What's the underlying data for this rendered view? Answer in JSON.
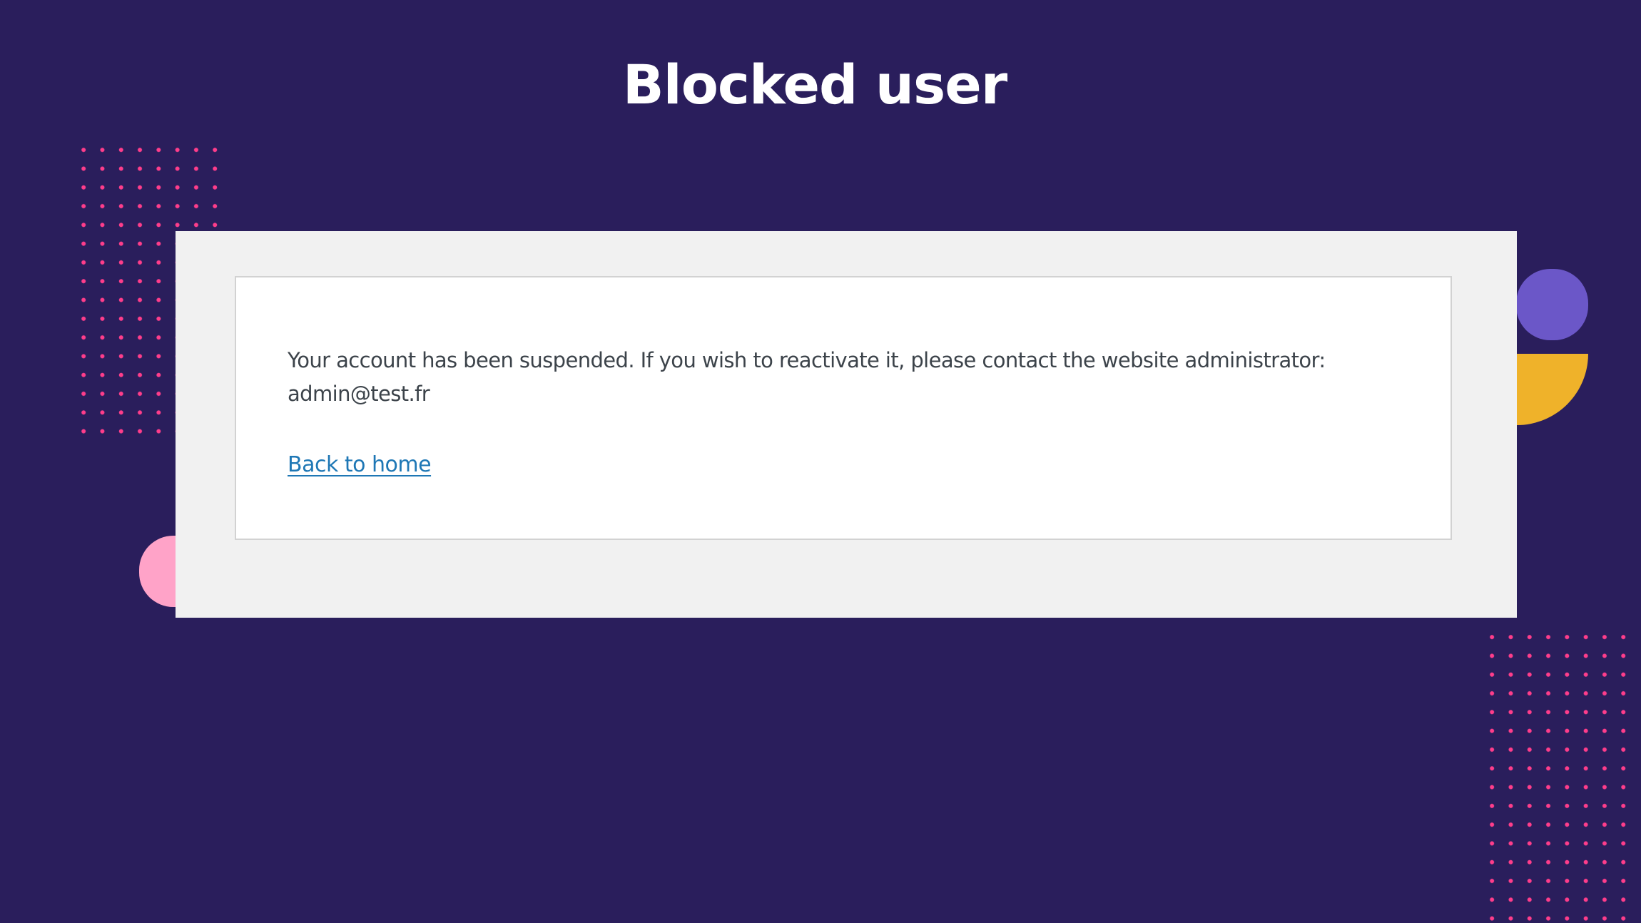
{
  "page": {
    "title": "Blocked user"
  },
  "message": {
    "text": "Your account has been suspended. If you wish to reactivate it, please contact the website administrator:",
    "email": "admin@test.fr"
  },
  "links": {
    "back_home": "Back to home"
  },
  "colors": {
    "background": "#2a1e5c",
    "dots": "#ff3d8b",
    "pink_blob": "#ffa3c8",
    "purple_blob": "#6b57c8",
    "yellow_blob": "#efb22a",
    "link": "#1e77b5"
  }
}
